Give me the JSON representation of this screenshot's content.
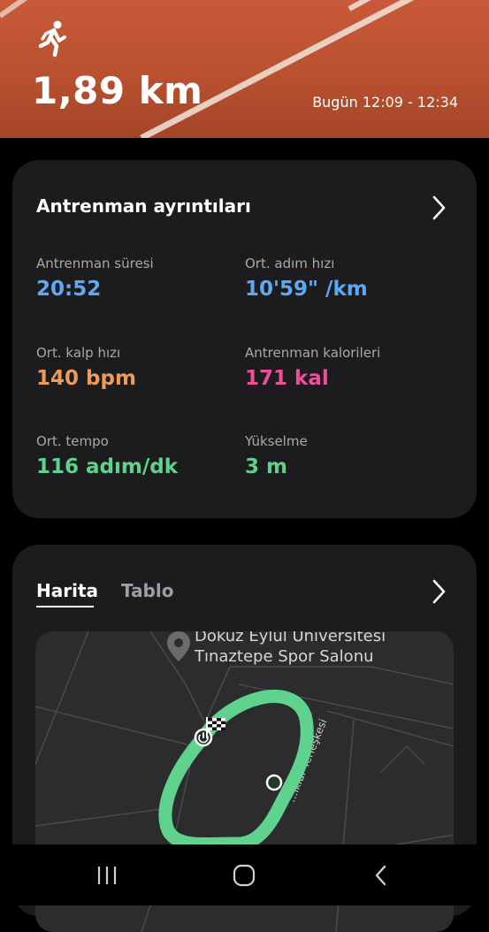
{
  "workout": {
    "distance": "1,89 km",
    "time_range": "Bugün 12:09 - 12:34"
  },
  "details": {
    "title": "Antrenman ayrıntıları",
    "metrics": [
      {
        "label": "Antrenman süresi",
        "value": "20:52",
        "color": "#5fa8f5"
      },
      {
        "label": "Ort. adım hızı",
        "value": "10'59\" /km",
        "color": "#5fa8f5"
      },
      {
        "label": "Ort. kalp hızı",
        "value": "140 bpm",
        "color": "#ee9a5c"
      },
      {
        "label": "Antrenman kalorileri",
        "value": "171 kal",
        "color": "#ef4f96"
      },
      {
        "label": "Ort. tempo",
        "value": "116 adım/dk",
        "color": "#5fd38d"
      },
      {
        "label": "Yükselme",
        "value": "3 m",
        "color": "#5fd38d"
      }
    ]
  },
  "map_card": {
    "tabs": [
      {
        "label": "Harita",
        "active": true
      },
      {
        "label": "Tablo",
        "active": false
      }
    ],
    "poi_line1": "Dokuz Eylül Üniversitesi",
    "poi_line2": "Tınaztepe Spor Salonu",
    "street": "…ıklar Yerleşkesi",
    "route_color": "#5fd38d"
  },
  "icons": {
    "runner": "runner-icon",
    "chevron": "chevron-right-icon",
    "poi": "location-pin-icon",
    "start": "start-marker-icon",
    "finish": "finish-flag-icon"
  },
  "nav": {
    "recent": "recent-apps-icon",
    "home": "home-icon",
    "back": "back-icon"
  }
}
